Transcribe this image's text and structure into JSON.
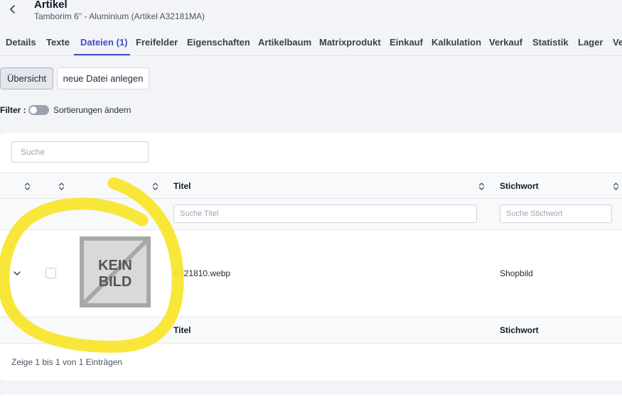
{
  "header": {
    "title": "Artikel",
    "subtitle": "Tamborim 6'' - Aluminium (Artikel A32181MA)"
  },
  "tabs": [
    {
      "label": "Details"
    },
    {
      "label": "Texte"
    },
    {
      "label": "Dateien (1)",
      "active": true
    },
    {
      "label": "Freifelder"
    },
    {
      "label": "Eigenschaften"
    },
    {
      "label": "Artikelbaum"
    },
    {
      "label": "Matrixprodukt"
    },
    {
      "label": "Einkauf"
    },
    {
      "label": "Kalkulation"
    },
    {
      "label": "Verkauf"
    },
    {
      "label": "Statistik"
    },
    {
      "label": "Lager"
    },
    {
      "label": "Ve"
    }
  ],
  "actions": {
    "overview_label": "Übersicht",
    "new_file_label": "neue Datei anlegen"
  },
  "filter": {
    "label": "Filter :",
    "toggle_label": "Sortierungen ändern",
    "toggle_on": false
  },
  "table": {
    "search_placeholder": "Suche",
    "columns": {
      "title": "Titel",
      "keyword": "Stichwort"
    },
    "filters": {
      "title_placeholder": "Suche Titel",
      "keyword_placeholder": "Suche Stichwort"
    },
    "rows": [
      {
        "image_placeholder": "KEIN BILD",
        "title": "A321810.webp",
        "keyword": "Shopbild"
      }
    ],
    "info": "Zeige 1 bis 1 von 1 Einträgen"
  },
  "icons": {
    "back": "chevron-left-icon",
    "sort": "sort-icon",
    "expand": "chevron-down-icon"
  },
  "colors": {
    "accent": "#3f4fbf",
    "annotation": "#f7e52a"
  }
}
